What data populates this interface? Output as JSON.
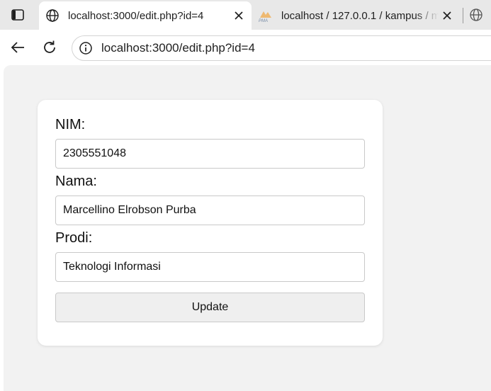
{
  "browser": {
    "tabs": [
      {
        "title": "localhost:3000/edit.php?id=4",
        "favicon": "globe-icon",
        "active": true
      },
      {
        "title": "localhost / 127.0.0.1 / kampus / m",
        "favicon": "phpmyadmin-icon",
        "active": false
      }
    ],
    "address_bar": {
      "url": "localhost:3000/edit.php?id=4"
    }
  },
  "form": {
    "nim": {
      "label": "NIM:",
      "value": "2305551048"
    },
    "nama": {
      "label": "Nama:",
      "value": "Marcellino Elrobson Purba"
    },
    "prodi": {
      "label": "Prodi:",
      "value": "Teknologi Informasi"
    },
    "submit_label": "Update"
  },
  "colors": {
    "tabstrip_bg": "#e8e8e8",
    "page_bg": "#f2f2f2",
    "card_bg": "#ffffff",
    "button_bg": "#efefef"
  }
}
